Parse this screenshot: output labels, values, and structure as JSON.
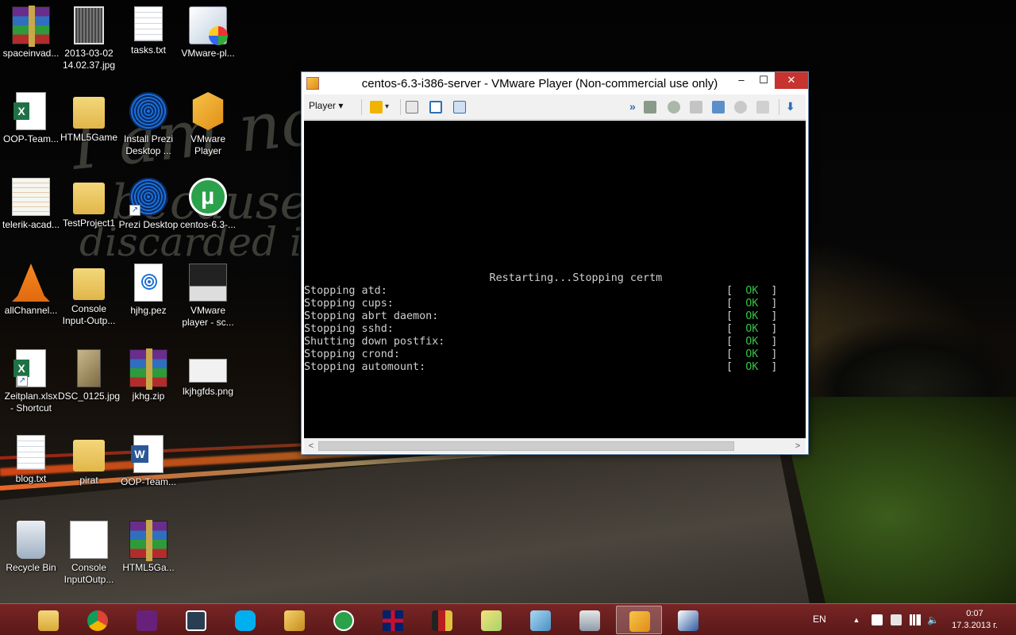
{
  "desktop": {
    "icons": [
      {
        "label": "spaceinvad...",
        "label2": ""
      },
      {
        "label": "2013-03-02",
        "label2": "14.02.37.jpg"
      },
      {
        "label": "tasks.txt",
        "label2": ""
      },
      {
        "label": "VMware-pl...",
        "label2": ""
      },
      {
        "label": "OOP-Team...",
        "label2": ""
      },
      {
        "label": "HTML5Game",
        "label2": ""
      },
      {
        "label": "Install Prezi",
        "label2": "Desktop ..."
      },
      {
        "label": "VMware",
        "label2": "Player"
      },
      {
        "label": "telerik-acad...",
        "label2": ""
      },
      {
        "label": "TestProject1",
        "label2": ""
      },
      {
        "label": "Prezi Desktop",
        "label2": ""
      },
      {
        "label": "centos-6.3-...",
        "label2": ""
      },
      {
        "label": "allChannel...",
        "label2": ""
      },
      {
        "label": "Console",
        "label2": "Input-Outp..."
      },
      {
        "label": "hjhg.pez",
        "label2": ""
      },
      {
        "label": "VMware",
        "label2": "player - sc..."
      },
      {
        "label": "Zeitplan.xlsx",
        "label2": "- Shortcut"
      },
      {
        "label": "DSC_0125.jpg",
        "label2": ""
      },
      {
        "label": "jkhg.zip",
        "label2": ""
      },
      {
        "label": "lkjhgfds.png",
        "label2": ""
      },
      {
        "label": "blog.txt",
        "label2": ""
      },
      {
        "label": "pirat",
        "label2": ""
      },
      {
        "label": "OOP-Team...",
        "label2": ""
      },
      {
        "label": "Recycle Bin",
        "label2": ""
      },
      {
        "label": "Console",
        "label2": "InputOutp..."
      },
      {
        "label": "HTML5Ga...",
        "label2": ""
      }
    ],
    "wallpaper_text": [
      "I am not",
      "because eve",
      "discarded is a"
    ]
  },
  "vm_window": {
    "title": "centos-6.3-i386-server - VMware Player (Non-commercial use only)",
    "min_glyph": "–",
    "max_glyph": "☐",
    "close_glyph": "✕",
    "toolbar": {
      "player_menu": "Player ▾",
      "more_glyph": "»",
      "dropdown_glyph": "▾"
    },
    "console": {
      "lines": [
        {
          "text": "",
          "status_open": "",
          "status": "",
          "status_close": ""
        },
        {
          "text": "",
          "status_open": "",
          "status": "",
          "status_close": ""
        },
        {
          "text": "",
          "status_open": "",
          "status": "",
          "status_close": ""
        },
        {
          "text": "",
          "status_open": "",
          "status": "",
          "status_close": ""
        },
        {
          "text": "",
          "status_open": "",
          "status": "",
          "status_close": ""
        },
        {
          "text": "",
          "status_open": "",
          "status": "",
          "status_close": ""
        },
        {
          "text": "",
          "status_open": "",
          "status": "",
          "status_close": ""
        },
        {
          "text": "",
          "status_open": "",
          "status": "",
          "status_close": ""
        },
        {
          "text": "",
          "status_open": "",
          "status": "",
          "status_close": ""
        },
        {
          "text": "                         Restarting...Stopping certm",
          "status_open": "[  ",
          "status": "OK",
          "status_close": "  ]"
        },
        {
          "text": "Stopping atd:",
          "status_open": "[  ",
          "status": "OK",
          "status_close": "  ]"
        },
        {
          "text": "Stopping cups:",
          "status_open": "[  ",
          "status": "OK",
          "status_close": "  ]"
        },
        {
          "text": "Stopping abrt daemon:",
          "status_open": "[  ",
          "status": "OK",
          "status_close": "  ]"
        },
        {
          "text": "Stopping sshd:",
          "status_open": "[  ",
          "status": "OK",
          "status_close": "  ]"
        },
        {
          "text": "Shutting down postfix:",
          "status_open": "[  ",
          "status": "OK",
          "status_close": "  ]"
        },
        {
          "text": "Stopping crond:",
          "status_open": "[  ",
          "status": "OK",
          "status_close": "  ]"
        },
        {
          "text": "Stopping automount:",
          "status_open": "",
          "status": "",
          "status_close": ""
        }
      ]
    },
    "scroll_left": "<",
    "scroll_right": ">"
  },
  "taskbar": {
    "apps": [
      "file-explorer-icon",
      "chrome-icon",
      "visual-studio-icon",
      "brackets-icon",
      "skype-icon",
      "winamp-icon",
      "utorrent-icon",
      "uk-flag-icon",
      "rar-books-icon",
      "sticky-folder-icon",
      "notepad-icon",
      "system-monitor-icon",
      "vmware-player-icon",
      "paint-icon"
    ],
    "active_app_index": 12,
    "tray": {
      "language": "EN",
      "up_arrow": "▲",
      "time": "0:07",
      "date": "17.3.2013 г."
    }
  },
  "colors": {
    "console_ok": "#36c046",
    "taskbar": "#7a2626",
    "close_button": "#c7332e"
  }
}
